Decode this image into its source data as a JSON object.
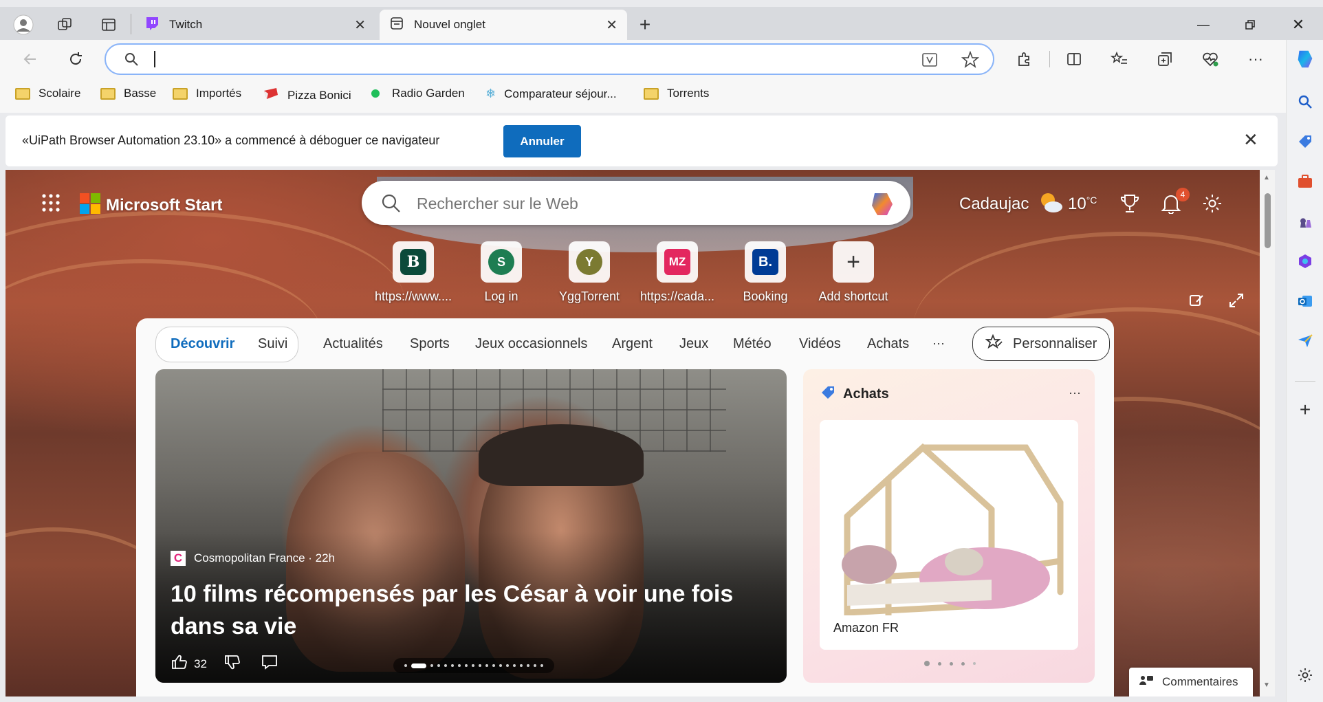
{
  "browser": {
    "tabs": [
      {
        "label": "Twitch",
        "active": false
      },
      {
        "label": "Nouvel onglet",
        "active": true
      }
    ],
    "address_value": "",
    "favorites": [
      {
        "label": "Scolaire",
        "icon": "folder-icon"
      },
      {
        "label": "Basse",
        "icon": "folder-icon"
      },
      {
        "label": "Importés",
        "icon": "folder-icon"
      },
      {
        "label": "Pizza Bonici",
        "icon": "pizza-icon"
      },
      {
        "label": "Radio Garden",
        "icon": "radio-dot-icon"
      },
      {
        "label": "Comparateur séjour...",
        "icon": "snowflake-icon"
      },
      {
        "label": "Torrents",
        "icon": "folder-icon"
      }
    ],
    "infobar": {
      "message": "«UiPath Browser Automation 23.10» a commencé à déboguer ce navigateur",
      "button": "Annuler"
    },
    "accent": "#0f6cbd"
  },
  "start": {
    "brand": "Microsoft Start",
    "search_placeholder": "Rechercher sur le Web",
    "location": "Cadaujac",
    "temperature": "10",
    "temp_unit": "°C",
    "notification_count": "4",
    "shortcuts": [
      {
        "label": "https://www....",
        "glyph": "B",
        "color": "#0b4a3a"
      },
      {
        "label": "Log in",
        "glyph": "S",
        "color": "#1e7d52"
      },
      {
        "label": "YggTorrent",
        "glyph": "Y",
        "color": "#7b7a31"
      },
      {
        "label": "https://cada...",
        "glyph": "MZ",
        "color": "#e3275f"
      },
      {
        "label": "Booking",
        "glyph": "B.",
        "color": "#003b95"
      },
      {
        "label": "Add shortcut",
        "glyph": "+",
        "color": "#333333"
      }
    ],
    "nav": {
      "discover": "Découvrir",
      "following": "Suivi",
      "tabs": [
        "Actualités",
        "Sports",
        "Jeux occasionnels",
        "Argent",
        "Jeux",
        "Météo",
        "Vidéos",
        "Achats"
      ],
      "more": "···",
      "personalize": "Personnaliser"
    },
    "hero": {
      "source": "Cosmopolitan France · 22h",
      "source_logo": "C",
      "headline": "10 films récompensés par les César à voir une fois dans sa vie",
      "likes": "32"
    },
    "shopping": {
      "title": "Achats",
      "store": "Amazon FR",
      "more": "···"
    },
    "feedback": "Commentaires"
  }
}
